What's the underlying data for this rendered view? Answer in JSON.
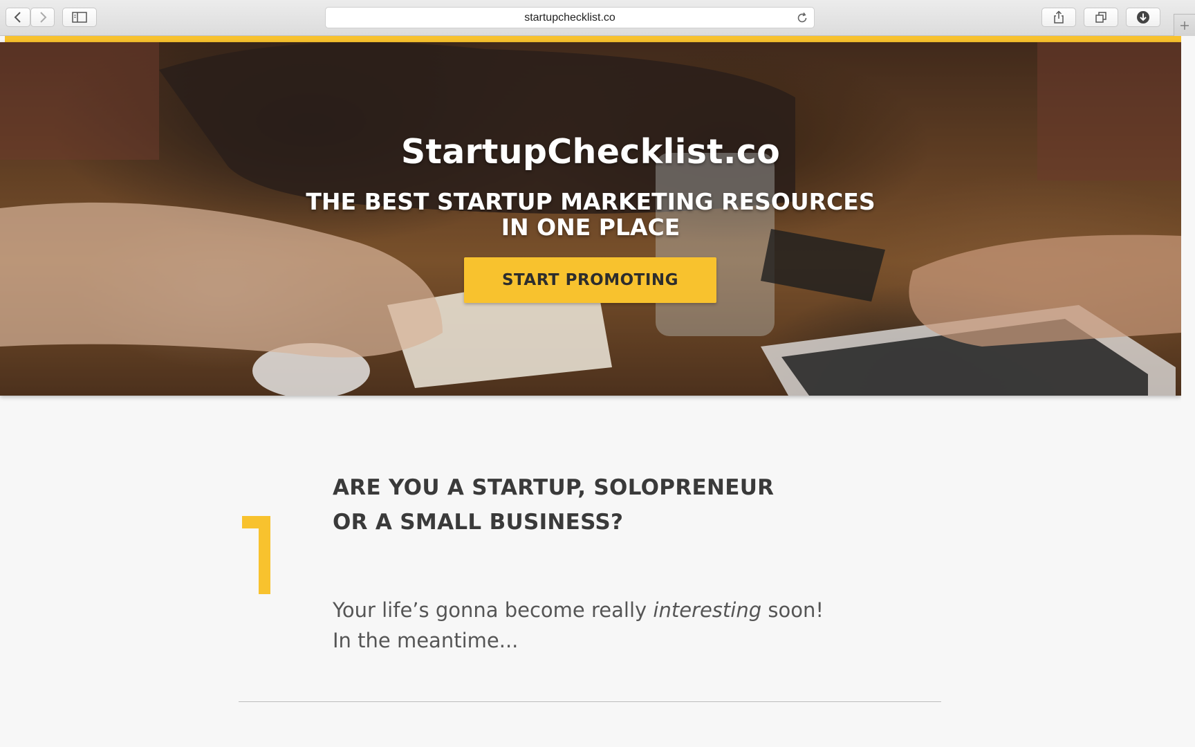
{
  "browser": {
    "url": "startupchecklist.co",
    "back_icon": "chevron-left-icon",
    "forward_icon": "chevron-right-icon",
    "sidebar_icon": "sidebar-icon",
    "reload_icon": "reload-icon",
    "share_icon": "share-icon",
    "tabs_icon": "tabs-overview-icon",
    "downloads_icon": "download-icon",
    "new_tab_icon": "plus-icon"
  },
  "colors": {
    "accent": "#f8c22e",
    "heading": "#3a3a3a",
    "body_text": "#555555",
    "page_bg": "#f7f7f7"
  },
  "hero": {
    "title": "StartupChecklist.co",
    "subtitle_line1": "THE BEST STARTUP MARKETING RESOURCES",
    "subtitle_line2": "IN ONE PLACE",
    "cta_label": "START PROMOTING"
  },
  "step": {
    "number": "1",
    "heading_line1": "ARE YOU A STARTUP, SOLOPRENEUR",
    "heading_line2": "OR A SMALL BUSINESS?",
    "text_before": "Your life’s gonna become really ",
    "text_emphasis": "interesting",
    "text_after": " soon!",
    "text_line2": "In the meantime..."
  }
}
